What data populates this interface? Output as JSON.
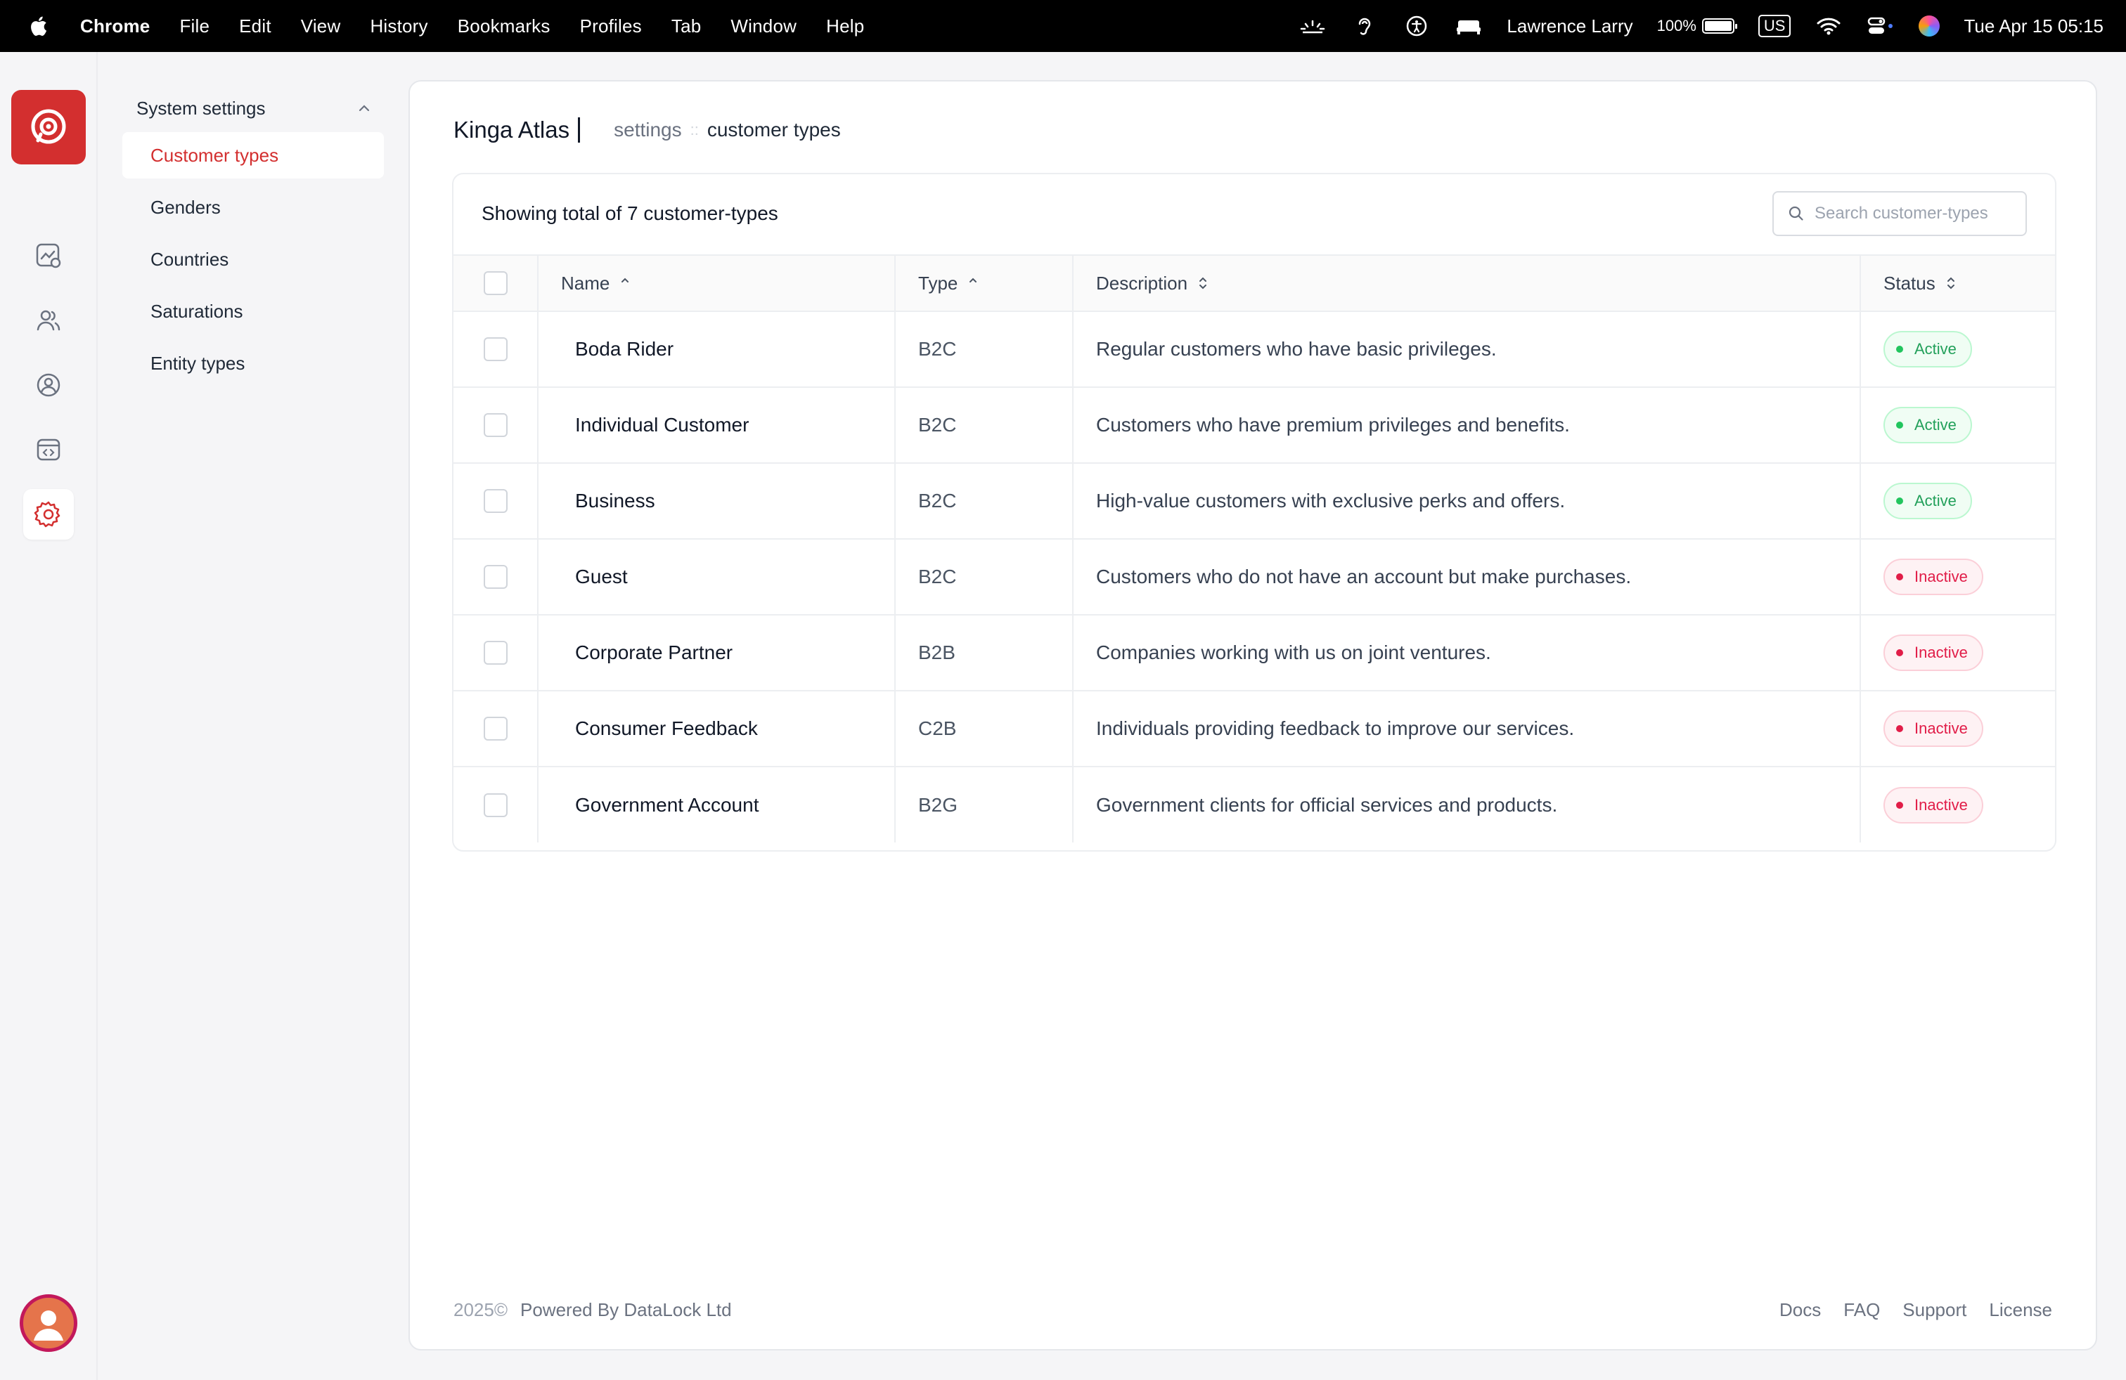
{
  "menubar": {
    "app": "Chrome",
    "items": [
      "File",
      "Edit",
      "View",
      "History",
      "Bookmarks",
      "Profiles",
      "Tab",
      "Window",
      "Help"
    ],
    "user": "Lawrence Larry",
    "battery": "100%",
    "input_source": "US",
    "datetime": "Tue Apr 15  05:15"
  },
  "rail": {
    "items": [
      "analytics-icon",
      "users-icon",
      "user-circle-icon",
      "code-window-icon",
      "gear-icon"
    ],
    "active": "gear-icon"
  },
  "settings_nav": {
    "heading": "System settings",
    "items": [
      {
        "label": "Customer types",
        "active": true
      },
      {
        "label": "Genders"
      },
      {
        "label": "Countries"
      },
      {
        "label": "Saturations"
      },
      {
        "label": "Entity types"
      }
    ]
  },
  "header": {
    "brand": "Kinga Atlas",
    "breadcrumb": [
      "settings",
      "customer types"
    ]
  },
  "table": {
    "summary": "Showing total of 7 customer-types",
    "search_placeholder": "Search customer-types",
    "columns": [
      "Name",
      "Type",
      "Description",
      "Status"
    ],
    "rows": [
      {
        "name": "Boda Rider",
        "type": "B2C",
        "description": "Regular customers who have basic privileges.",
        "status": "Active"
      },
      {
        "name": "Individual Customer",
        "type": "B2C",
        "description": "Customers who have premium privileges and benefits.",
        "status": "Active"
      },
      {
        "name": "Business",
        "type": "B2C",
        "description": "High-value customers with exclusive perks and offers.",
        "status": "Active"
      },
      {
        "name": "Guest",
        "type": "B2C",
        "description": "Customers who do not have an account but make purchases.",
        "status": "Inactive"
      },
      {
        "name": "Corporate Partner",
        "type": "B2B",
        "description": "Companies working with us on joint ventures.",
        "status": "Inactive"
      },
      {
        "name": "Consumer Feedback",
        "type": "C2B",
        "description": "Individuals providing feedback to improve our services.",
        "status": "Inactive"
      },
      {
        "name": "Government Account",
        "type": "B2G",
        "description": "Government clients for official services and products.",
        "status": "Inactive"
      }
    ]
  },
  "footer": {
    "copyright": "2025©",
    "powered": "Powered By DataLock Ltd",
    "links": [
      "Docs",
      "FAQ",
      "Support",
      "License"
    ]
  },
  "colors": {
    "accent": "#d32f2f",
    "active_badge": "#22a05a",
    "inactive_badge": "#e11d48"
  }
}
